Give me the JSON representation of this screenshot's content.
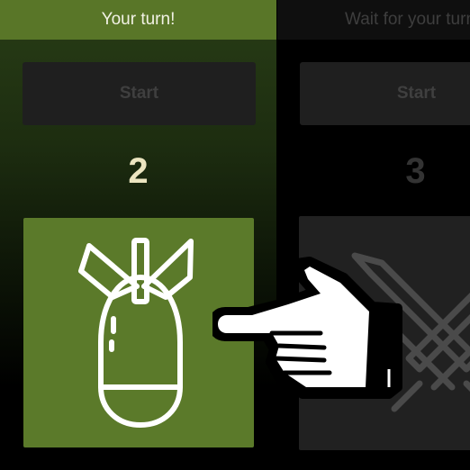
{
  "player": {
    "status": "Your turn!",
    "start_label": "Start",
    "count": "2",
    "card_icon": "bomb-icon"
  },
  "opponent": {
    "status": "Wait for your turn",
    "start_label": "Start",
    "count": "3",
    "card_icon": "crossed-swords-icon"
  },
  "overlay_icon": "pointing-hand-icon",
  "colors": {
    "active_green": "#597628",
    "card_green": "#5b7a2a",
    "count_active": "#ece5c0",
    "inactive_gray": "#212121"
  }
}
